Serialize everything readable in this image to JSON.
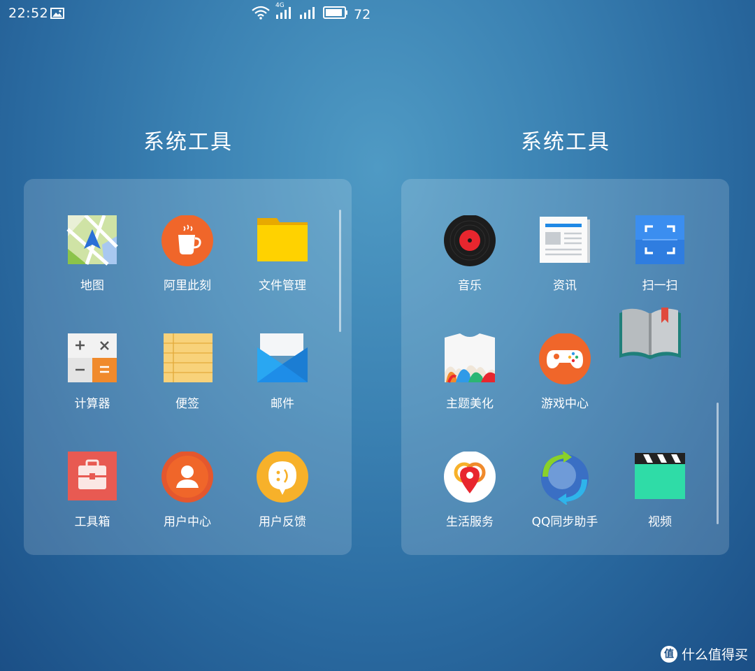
{
  "status_bar": {
    "time": "22:52",
    "network": "4G",
    "battery": "72"
  },
  "folders": [
    {
      "title": "系统工具",
      "apps": [
        {
          "label": "地图",
          "icon": "map-icon"
        },
        {
          "label": "阿里此刻",
          "icon": "coffee-cup-icon"
        },
        {
          "label": "文件管理",
          "icon": "folder-icon"
        },
        {
          "label": "计算器",
          "icon": "calculator-icon"
        },
        {
          "label": "便签",
          "icon": "notepad-icon"
        },
        {
          "label": "邮件",
          "icon": "mail-icon"
        },
        {
          "label": "工具箱",
          "icon": "toolbox-icon"
        },
        {
          "label": "用户中心",
          "icon": "user-icon"
        },
        {
          "label": "用户反馈",
          "icon": "feedback-icon"
        }
      ]
    },
    {
      "title": "系统工具",
      "apps": [
        {
          "label": "音乐",
          "icon": "vinyl-record-icon"
        },
        {
          "label": "资讯",
          "icon": "newspaper-icon"
        },
        {
          "label": "扫一扫",
          "icon": "scan-icon"
        },
        {
          "label": "主题美化",
          "icon": "tshirt-theme-icon"
        },
        {
          "label": "游戏中心",
          "icon": "gamepad-icon"
        },
        {
          "label": "生活服务",
          "icon": "location-pin-icon"
        },
        {
          "label": "QQ同步助手",
          "icon": "sync-globe-icon"
        },
        {
          "label": "视频",
          "icon": "clapperboard-icon"
        }
      ]
    }
  ],
  "dragging_app": {
    "icon": "book-icon"
  },
  "watermark": {
    "text": "什么值得买",
    "logo": "值"
  }
}
